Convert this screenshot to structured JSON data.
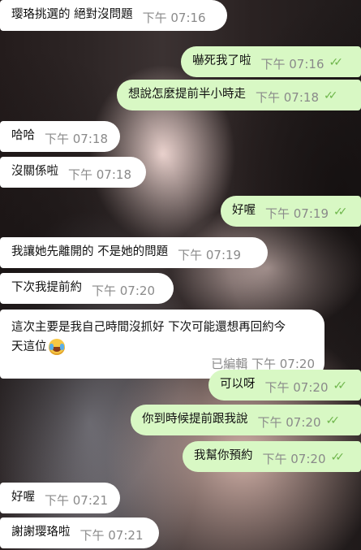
{
  "messages": [
    {
      "dir": "in",
      "text": "璎珞挑選的 絕對沒問題",
      "time": "下午 07:16"
    },
    {
      "dir": "out",
      "text": "嚇死我了啦",
      "time": "下午 07:16",
      "read": "✓✓"
    },
    {
      "dir": "out",
      "text": "想說怎麼提前半小時走",
      "time": "下午 07:18",
      "read": "✓✓"
    },
    {
      "dir": "in",
      "text": "哈哈",
      "time": "下午 07:18"
    },
    {
      "dir": "in",
      "text": "沒關係啦",
      "time": "下午 07:18"
    },
    {
      "dir": "out",
      "text": "好喔",
      "time": "下午 07:19",
      "read": "✓✓"
    },
    {
      "dir": "in",
      "text": "我讓她先離開的 不是她的問題",
      "time": "下午 07:19"
    },
    {
      "dir": "in",
      "text": "下次我提前約",
      "time": "下午 07:20"
    },
    {
      "dir": "in",
      "text_line1": "這次主要是我自己時間沒抓好 下次可能還想再回約今",
      "text_line2": "天這位",
      "emoji": "face-with-tears-of-joy",
      "edited": "已編輯",
      "time": "下午 07:20"
    },
    {
      "dir": "out",
      "text": "可以呀",
      "time": "下午 07:20",
      "read": "✓✓"
    },
    {
      "dir": "out",
      "text": "你到時候提前跟我說",
      "time": "下午 07:20",
      "read": "✓✓"
    },
    {
      "dir": "out",
      "text": "我幫你預約",
      "time": "下午 07:20",
      "read": "✓✓"
    },
    {
      "dir": "in",
      "text": "好喔",
      "time": "下午 07:21"
    },
    {
      "dir": "in",
      "text": "謝謝璎珞啦",
      "time": "下午 07:21"
    }
  ],
  "colors": {
    "incoming_bubble": "#ffffff",
    "outgoing_bubble": "#d8f8c4",
    "read_ticks": "#6fb64c",
    "timestamp": "#8a8a8a"
  }
}
